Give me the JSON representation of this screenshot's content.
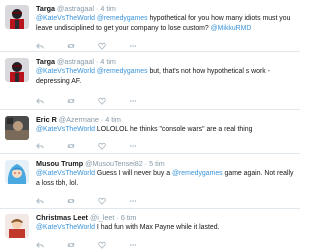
{
  "tweets": [
    {
      "name": "Targa",
      "handle": "@astragaal",
      "sep": "·",
      "time": "4 tim",
      "segments": [
        {
          "t": "@KateVsTheWorld",
          "m": true
        },
        {
          "t": " ",
          "m": false
        },
        {
          "t": "@remedygames",
          "m": true
        },
        {
          "t": " hypothetical for you how many idiots must you leave undisciplined to get your company to lose custom? ",
          "m": false
        },
        {
          "t": "@MikkuRMD",
          "m": true
        }
      ],
      "avatar_icon": "armored-hero-avatar-icon"
    },
    {
      "name": "Targa",
      "handle": "@astragaal",
      "sep": "·",
      "time": "4 tim",
      "segments": [
        {
          "t": "@KateVsTheWorld",
          "m": true
        },
        {
          "t": " ",
          "m": false
        },
        {
          "t": "@remedygames",
          "m": true
        },
        {
          "t": " but, that's not how hypothetical s work - depressing AF.",
          "m": false
        }
      ],
      "avatar_icon": "armored-hero-avatar-icon"
    },
    {
      "name": "Eric R",
      "handle": "@Azermane",
      "sep": "·",
      "time": "4 tim",
      "segments": [
        {
          "t": "@KateVsTheWorld",
          "m": true
        },
        {
          "t": " LOLOLOL he thinks \"console wars\" are a real thing",
          "m": false
        }
      ],
      "avatar_icon": "photo-avatar-icon"
    },
    {
      "name": "Musou Trump",
      "handle": "@MusouTensei82",
      "sep": "·",
      "time": "5 tim",
      "segments": [
        {
          "t": "@KateVsTheWorld",
          "m": true
        },
        {
          "t": " Guess I will never buy a ",
          "m": false
        },
        {
          "t": "@remedygames",
          "m": true
        },
        {
          "t": " game again. Not really a loss tbh, lol.",
          "m": false
        }
      ],
      "avatar_icon": "blue-hair-character-avatar-icon"
    },
    {
      "name": "Christmas Leet",
      "handle": "@i_leet",
      "sep": "·",
      "time": "6 tim",
      "segments": [
        {
          "t": "@KateVsTheWorld",
          "m": true
        },
        {
          "t": " I had fun with Max Payne while it lasted.",
          "m": false
        }
      ],
      "avatar_icon": "character-avatar-icon"
    }
  ],
  "colors": {
    "mention": "#3b94d9",
    "meta": "#8899a6",
    "action": "#aab8c2",
    "divider": "#e1e8ed"
  }
}
